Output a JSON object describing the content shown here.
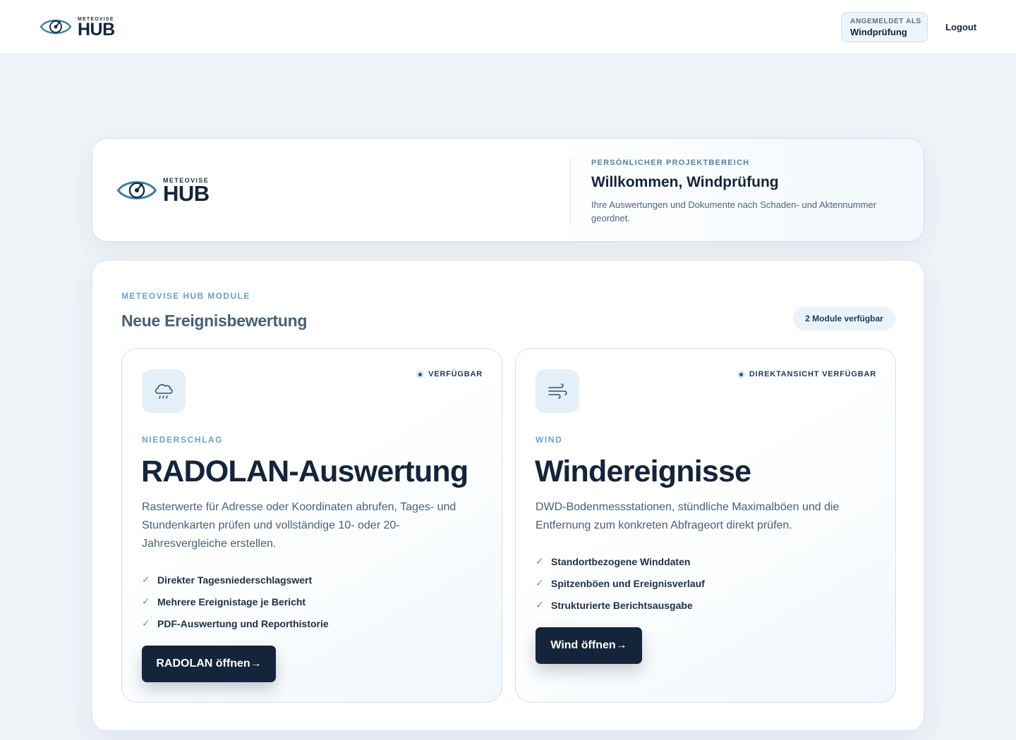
{
  "header": {
    "logo_sup": "METEOVISE",
    "logo_main": "HUB",
    "user_badge_label": "ANGEMELDET ALS",
    "user_name": "Windprüfung",
    "logout_label": "Logout"
  },
  "welcome": {
    "logo_sup": "METEOVISE",
    "logo_main": "HUB",
    "eyebrow": "PERSÖNLICHER PROJEKTBEREICH",
    "title": "Willkommen, Windprüfung",
    "description": "Ihre Auswertungen und Dokumente nach Schaden- und Aktennummer geordnet."
  },
  "modules": {
    "eyebrow": "METEOVISE HUB MODULE",
    "title": "Neue Ereignisbewertung",
    "count_label": "2 Module verfügbar",
    "cards": [
      {
        "icon": "rain-cloud-icon",
        "status": "VERFÜGBAR",
        "kicker": "NIEDERSCHLAG",
        "title": "RADOLAN-Auswertung",
        "description": "Rasterwerte für Adresse oder Koordinaten abrufen, Tages- und Stundenkarten prüfen und vollständige 10- oder 20-Jahresvergleiche erstellen.",
        "features": [
          "Direkter Tagesniederschlagswert",
          "Mehrere Ereignistage je Bericht",
          "PDF-Auswertung und Reporthistorie"
        ],
        "button_label": "RADOLAN öffnen→"
      },
      {
        "icon": "wind-icon",
        "status": "DIREKTANSICHT VERFÜGBAR",
        "kicker": "WIND",
        "title": "Windereignisse",
        "description": "DWD-Bodenmessstationen, stündliche Maximalböen und die Entfernung zum konkreten Abfrageort direkt prüfen.",
        "features": [
          "Standortbezogene Winddaten",
          "Spitzenböen und Ereignisverlauf",
          "Strukturierte Berichtsausgabe"
        ],
        "button_label": "Wind öffnen→"
      }
    ]
  },
  "colors": {
    "primary_dark": "#14243b",
    "accent_blue": "#6aa4c8",
    "page_background": "#eef3f7"
  }
}
